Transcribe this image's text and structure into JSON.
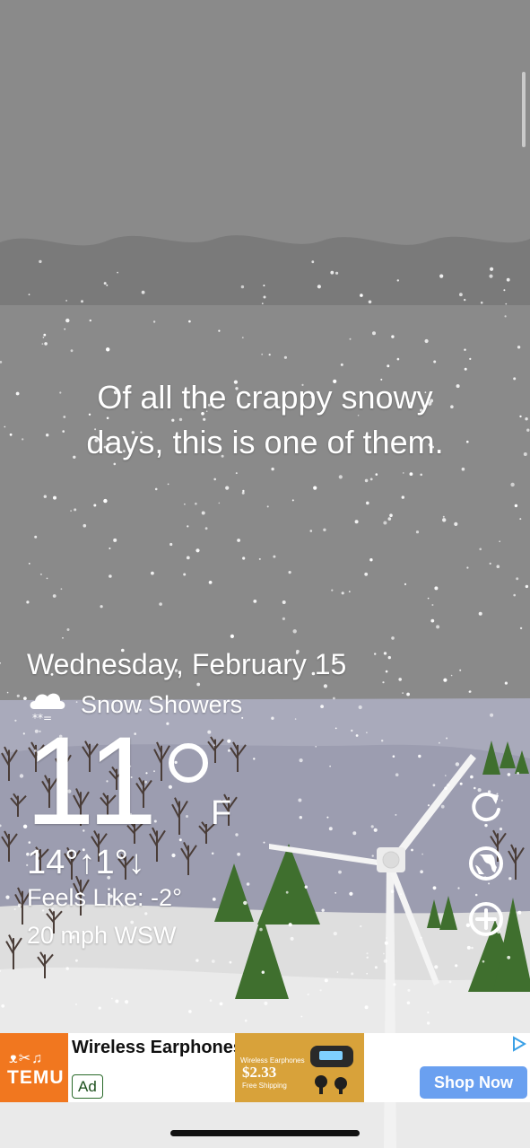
{
  "quote": {
    "line1": "Of all the crappy snowy",
    "line2": "days, this is one of them."
  },
  "weather": {
    "date": "Wednesday, February 15",
    "condition": "Snow Showers",
    "condition_icon": "snow-cloud-icon",
    "temperature": "11",
    "unit": "F",
    "hilo": "14°↑1°↓",
    "feels_like": "Feels Like: -2°",
    "wind": "20 mph WSW"
  },
  "controls": [
    "refresh-icon",
    "globe-icon",
    "add-icon"
  ],
  "ad": {
    "brand": "TEMU",
    "brand_glyphs": "ᴥ✂♫",
    "title": "Wireless Earphones",
    "badge": "Ad",
    "product_heading": "Wireless Earphones",
    "product_price": "$2.33",
    "product_shipping": "Free Shipping",
    "cta": "Shop Now",
    "colors": {
      "brand": "#f1771f",
      "cta": "#6aa0f0"
    }
  }
}
